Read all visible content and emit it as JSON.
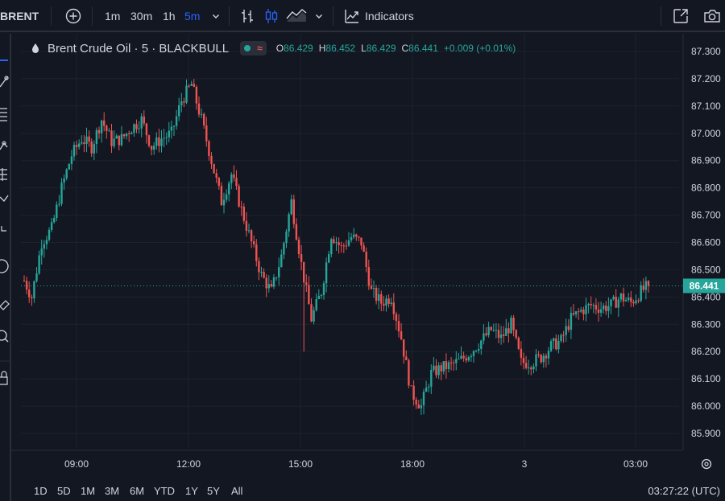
{
  "toolbar": {
    "symbol": "BRENT",
    "intervals": [
      "1m",
      "30m",
      "1h",
      "5m"
    ],
    "active_interval": "5m",
    "indicators_label": "Indicators"
  },
  "legend": {
    "title": "Brent Crude Oil · 5 · BLACKBULL",
    "o_key": "O",
    "o_val": "86.429",
    "h_key": "H",
    "h_val": "86.452",
    "l_key": "L",
    "l_val": "86.429",
    "c_key": "C",
    "c_val": "86.441",
    "change": "+0.009 (+0.01%)"
  },
  "ranges": [
    "1D",
    "5D",
    "1M",
    "3M",
    "6M",
    "YTD",
    "1Y",
    "5Y",
    "All"
  ],
  "clock": "03:27:22 (UTC)",
  "colors": {
    "up": "#26a69a",
    "down": "#ef5350",
    "background": "#131722",
    "grid": "#1e222d",
    "accent": "#2962ff"
  },
  "icons": [
    "plus-circle-icon",
    "chevron-down-icon",
    "bar-chart-icon",
    "candles-icon",
    "area-chart-icon",
    "indicators-icon",
    "fullscreen-icon",
    "camera-icon",
    "settings-icon"
  ],
  "chart_data": {
    "type": "candlestick",
    "symbol": "Brent Crude Oil",
    "interval_minutes": 5,
    "ylim": [
      85.85,
      87.35
    ],
    "y_ticks": [
      "87.300",
      "87.200",
      "87.100",
      "87.000",
      "86.900",
      "86.800",
      "86.700",
      "86.600",
      "86.500",
      "86.400",
      "86.300",
      "86.200",
      "86.100",
      "86.000",
      "85.900"
    ],
    "x_ticks": [
      "09:00",
      "12:00",
      "15:00",
      "18:00",
      "3",
      "03:00"
    ],
    "last_price": 86.441,
    "last_price_label": "86.441",
    "grid": true,
    "anchors": [
      [
        0,
        86.46
      ],
      [
        3,
        86.4
      ],
      [
        7,
        86.6
      ],
      [
        11,
        86.65
      ],
      [
        15,
        86.8
      ],
      [
        19,
        86.92
      ],
      [
        23,
        86.98
      ],
      [
        27,
        86.95
      ],
      [
        31,
        87.05
      ],
      [
        35,
        86.97
      ],
      [
        39,
        86.98
      ],
      [
        43,
        87.02
      ],
      [
        47,
        87.05
      ],
      [
        51,
        86.95
      ],
      [
        55,
        86.98
      ],
      [
        59,
        87.0
      ],
      [
        63,
        87.12
      ],
      [
        67,
        87.18
      ],
      [
        71,
        87.05
      ],
      [
        75,
        86.9
      ],
      [
        79,
        86.75
      ],
      [
        83,
        86.85
      ],
      [
        87,
        86.72
      ],
      [
        91,
        86.6
      ],
      [
        95,
        86.48
      ],
      [
        99,
        86.42
      ],
      [
        103,
        86.55
      ],
      [
        107,
        86.75
      ],
      [
        111,
        86.52
      ],
      [
        115,
        86.32
      ],
      [
        119,
        86.42
      ],
      [
        123,
        86.63
      ],
      [
        127,
        86.58
      ],
      [
        131,
        86.62
      ],
      [
        135,
        86.6
      ],
      [
        139,
        86.42
      ],
      [
        143,
        86.38
      ],
      [
        147,
        86.4
      ],
      [
        151,
        86.25
      ],
      [
        155,
        86.05
      ],
      [
        159,
        86.0
      ],
      [
        163,
        86.12
      ],
      [
        167,
        86.14
      ],
      [
        171,
        86.15
      ],
      [
        175,
        86.17
      ],
      [
        179,
        86.2
      ],
      [
        183,
        86.24
      ],
      [
        187,
        86.28
      ],
      [
        191,
        86.25
      ],
      [
        195,
        86.3
      ],
      [
        199,
        86.16
      ],
      [
        203,
        86.16
      ],
      [
        207,
        86.18
      ],
      [
        211,
        86.22
      ],
      [
        215,
        86.24
      ],
      [
        219,
        86.32
      ],
      [
        223,
        86.35
      ],
      [
        227,
        86.37
      ],
      [
        231,
        86.36
      ],
      [
        235,
        86.37
      ],
      [
        239,
        86.4
      ],
      [
        243,
        86.38
      ],
      [
        247,
        86.42
      ],
      [
        250,
        86.441
      ]
    ],
    "spikes": [
      [
        125,
        86.62
      ],
      [
        112,
        86.2
      ],
      [
        160,
        85.97
      ]
    ]
  }
}
